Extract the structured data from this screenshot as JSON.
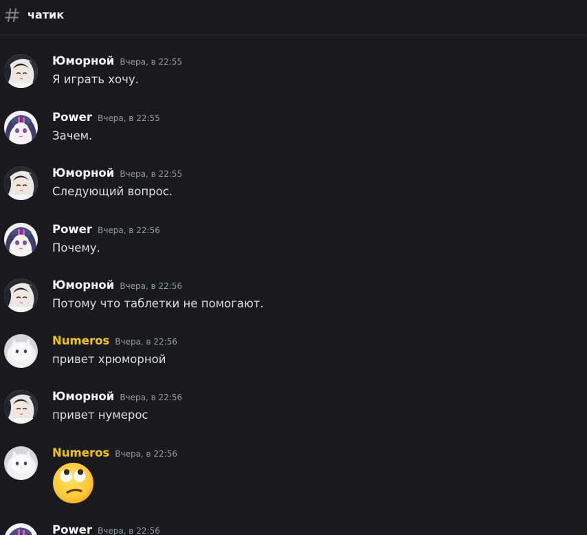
{
  "channel": {
    "icon": "hash-icon",
    "name": "чатик"
  },
  "colors": {
    "background": "#1a1a1e",
    "username_default": "#f2f3f5",
    "username_numeros": "#f0c31a",
    "timestamp": "#949ba4"
  },
  "messages": [
    {
      "author": "Юморной",
      "avatar": "avatar-yumornoy",
      "time": "Вчера, в 22:55",
      "text": "Я играть хочу."
    },
    {
      "author": "Power",
      "avatar": "avatar-power",
      "time": "Вчера, в 22:55",
      "text": "Зачем."
    },
    {
      "author": "Юморной",
      "avatar": "avatar-yumornoy",
      "time": "Вчера, в 22:55",
      "text": "Следующий вопрос."
    },
    {
      "author": "Power",
      "avatar": "avatar-power",
      "time": "Вчера, в 22:56",
      "text": "Почему."
    },
    {
      "author": "Юморной",
      "avatar": "avatar-yumornoy",
      "time": "Вчера, в 22:56",
      "text": "Потому что таблетки не помогают."
    },
    {
      "author": "Numeros",
      "avatar": "avatar-numeros",
      "time": "Вчера, в 22:56",
      "text": "привет хрюморной"
    },
    {
      "author": "Юморной",
      "avatar": "avatar-yumornoy",
      "time": "Вчера, в 22:56",
      "text": "привет нумерос"
    },
    {
      "author": "Numeros",
      "avatar": "avatar-numeros",
      "time": "Вчера, в 22:56",
      "emoji": "face-with-rolling-eyes-emoji"
    },
    {
      "author": "Power",
      "avatar": "avatar-power",
      "time": "Вчера, в 22:56",
      "text": ""
    }
  ]
}
